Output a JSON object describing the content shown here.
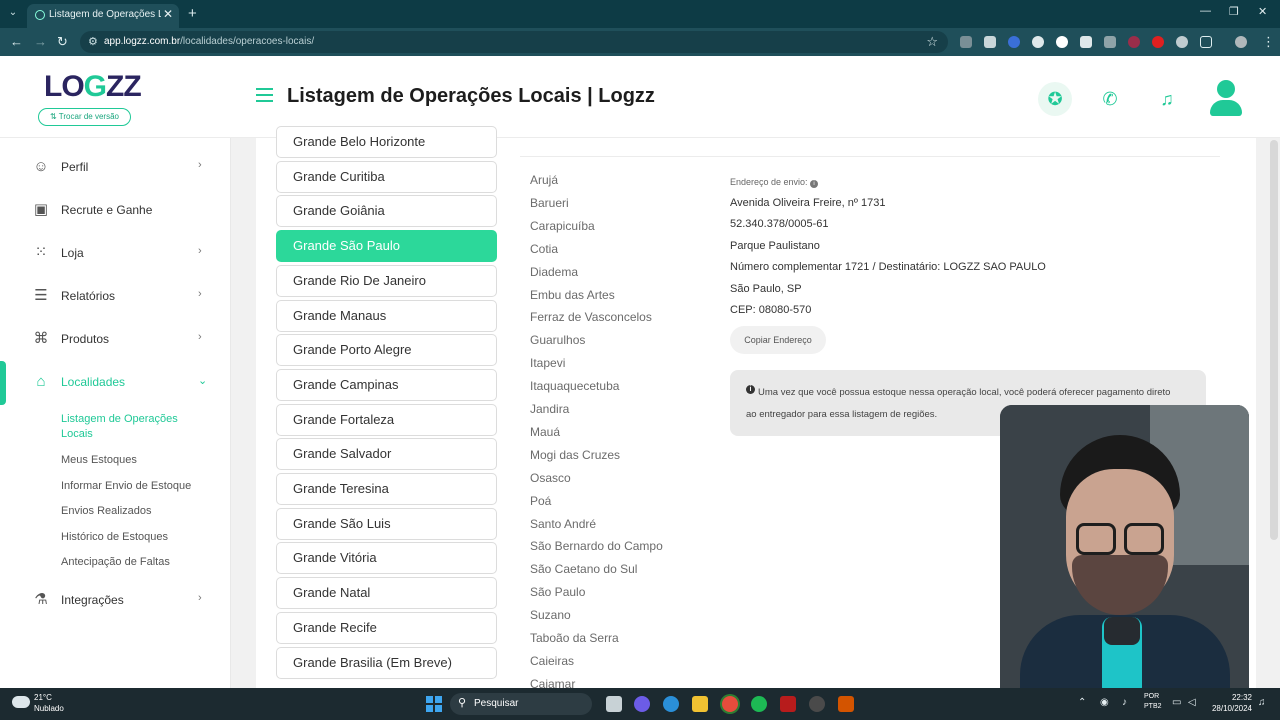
{
  "browser": {
    "tab_title": "Listagem de Operações Locais",
    "url_host": "app.logzz.com.br",
    "url_path": "/localidades/operacoes-locais/"
  },
  "header": {
    "logo_text": "LOGZZ",
    "switch_version": "⇅ Trocar de versão",
    "page_title": "Listagem de Operações Locais | Logzz"
  },
  "sidebar": {
    "items": [
      {
        "label": "Perfil"
      },
      {
        "label": "Recrute e Ganhe"
      },
      {
        "label": "Loja"
      },
      {
        "label": "Relatórios"
      },
      {
        "label": "Produtos"
      },
      {
        "label": "Localidades"
      },
      {
        "label": "Integrações"
      }
    ],
    "subitems": [
      {
        "label": "Listagem de Operações Locais"
      },
      {
        "label": "Meus Estoques"
      },
      {
        "label": "Informar Envio de Estoque"
      },
      {
        "label": "Envios Realizados"
      },
      {
        "label": "Histórico de Estoques"
      },
      {
        "label": "Antecipação de Faltas"
      }
    ]
  },
  "regions": [
    "Grande Belo Horizonte",
    "Grande Curitiba",
    "Grande Goiânia",
    "Grande São Paulo",
    "Grande Rio De Janeiro",
    "Grande Manaus",
    "Grande Porto Alegre",
    "Grande Campinas",
    "Grande Fortaleza",
    "Grande Salvador",
    "Grande Teresina",
    "Grande São Luis",
    "Grande Vitória",
    "Grande Natal",
    "Grande Recife",
    "Grande Brasilia (Em Breve)"
  ],
  "selected_region": "Grande São Paulo",
  "cities": [
    "Arujá",
    "Barueri",
    "Carapicuíba",
    "Cotia",
    "Diadema",
    "Embu das Artes",
    "Ferraz de Vasconcelos",
    "Guarulhos",
    "Itapevi",
    "Itaquaquecetuba",
    "Jandira",
    "Mauá",
    "Mogi das Cruzes",
    "Osasco",
    "Poá",
    "Santo André",
    "São Bernardo do Campo",
    "São Caetano do Sul",
    "São Paulo",
    "Suzano",
    "Taboão da Serra",
    "Caieiras",
    "Cajamar"
  ],
  "address": {
    "title": "Endereço de envio:",
    "lines": [
      "Avenida Oliveira Freire, nº 1731",
      "52.340.378/0005-61",
      "Parque Paulistano",
      "Número complementar 1721 / Destinatário: LOGZZ SAO PAULO",
      "São Paulo, SP",
      "CEP: 08080-570"
    ],
    "copy_button": "Copiar Endereço",
    "note": "Uma vez que você possua estoque nessa operação local, você poderá oferecer pagamento direto ao entregador para essa listagem de regiões."
  },
  "taskbar": {
    "temp": "21°C",
    "weather": "Nublado",
    "search": "Pesquisar",
    "lang1": "POR",
    "lang2": "PTB2",
    "time": "22:32",
    "date": "28/10/2024"
  },
  "colors": {
    "accent": "#20c997",
    "brand_dark": "#2b2560",
    "chrome": "#1f4f5a"
  }
}
